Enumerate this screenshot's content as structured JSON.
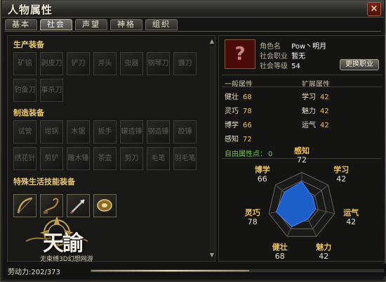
{
  "window": {
    "title": "人物属性",
    "close_label": "×"
  },
  "tabs": [
    {
      "label": "基本",
      "active": false
    },
    {
      "label": "社会",
      "active": true
    },
    {
      "label": "声望",
      "active": false
    },
    {
      "label": "神格",
      "active": false
    },
    {
      "label": "组织",
      "active": false
    }
  ],
  "sections": {
    "production": {
      "title": "生产装备",
      "slots": [
        "矿镐",
        "剥皮刀",
        "铲刀",
        "斧头",
        "虫器",
        "钢琴刀",
        "镰刀",
        "钓鱼刀",
        "事杀刀"
      ]
    },
    "crafting": {
      "title": "制造装备",
      "slots": [
        "试管",
        "坩锅",
        "木锯",
        "扳手",
        "罐造锤",
        "钢造锤",
        "胶锤",
        "绣花针",
        "剪铲",
        "雕木锤",
        "茶壶",
        "剪刀",
        "毛笔",
        "羽毛笔"
      ]
    },
    "special": {
      "title": "特殊生活技能装备",
      "item_icons": [
        "bow-tool-icon",
        "whip-tool-icon",
        "arrow-tool-icon",
        "shield-tool-icon"
      ]
    }
  },
  "logo": {
    "text": "天諭",
    "subtitle": "无束缚3D幻想网游"
  },
  "character": {
    "portrait_symbol": "?",
    "name_label": "角色名",
    "name_value": "Pow丶明月",
    "job_label": "社会职业",
    "job_value": "暂无",
    "level_label": "社会等级",
    "level_value": "54",
    "change_job_label": "更换职业"
  },
  "attributes": {
    "general_title": "一般属性",
    "extended_title": "扩展属性",
    "general": [
      {
        "name": "健壮",
        "value": "68"
      },
      {
        "name": "灵巧",
        "value": "78"
      },
      {
        "name": "博学",
        "value": "66"
      },
      {
        "name": "感知",
        "value": "72"
      }
    ],
    "extended": [
      {
        "name": "学习",
        "value": "42"
      },
      {
        "name": "魅力",
        "value": "42"
      },
      {
        "name": "运气",
        "value": "42"
      }
    ],
    "free_points_label": "自由属性点：",
    "free_points_value": "0"
  },
  "radar": {
    "axes": [
      {
        "name": "感知",
        "value": 72
      },
      {
        "name": "学习",
        "value": 42
      },
      {
        "name": "运气",
        "value": 42
      },
      {
        "name": "魅力",
        "value": 42
      },
      {
        "name": "健壮",
        "value": 68
      },
      {
        "name": "灵巧",
        "value": 78
      },
      {
        "name": "博学",
        "value": 66
      }
    ],
    "max": 100,
    "fill_color": "#1d5fc8",
    "label_color": "#eec15a"
  },
  "energy": {
    "label": "劳动力:202/373",
    "current": 202,
    "max": 373
  }
}
